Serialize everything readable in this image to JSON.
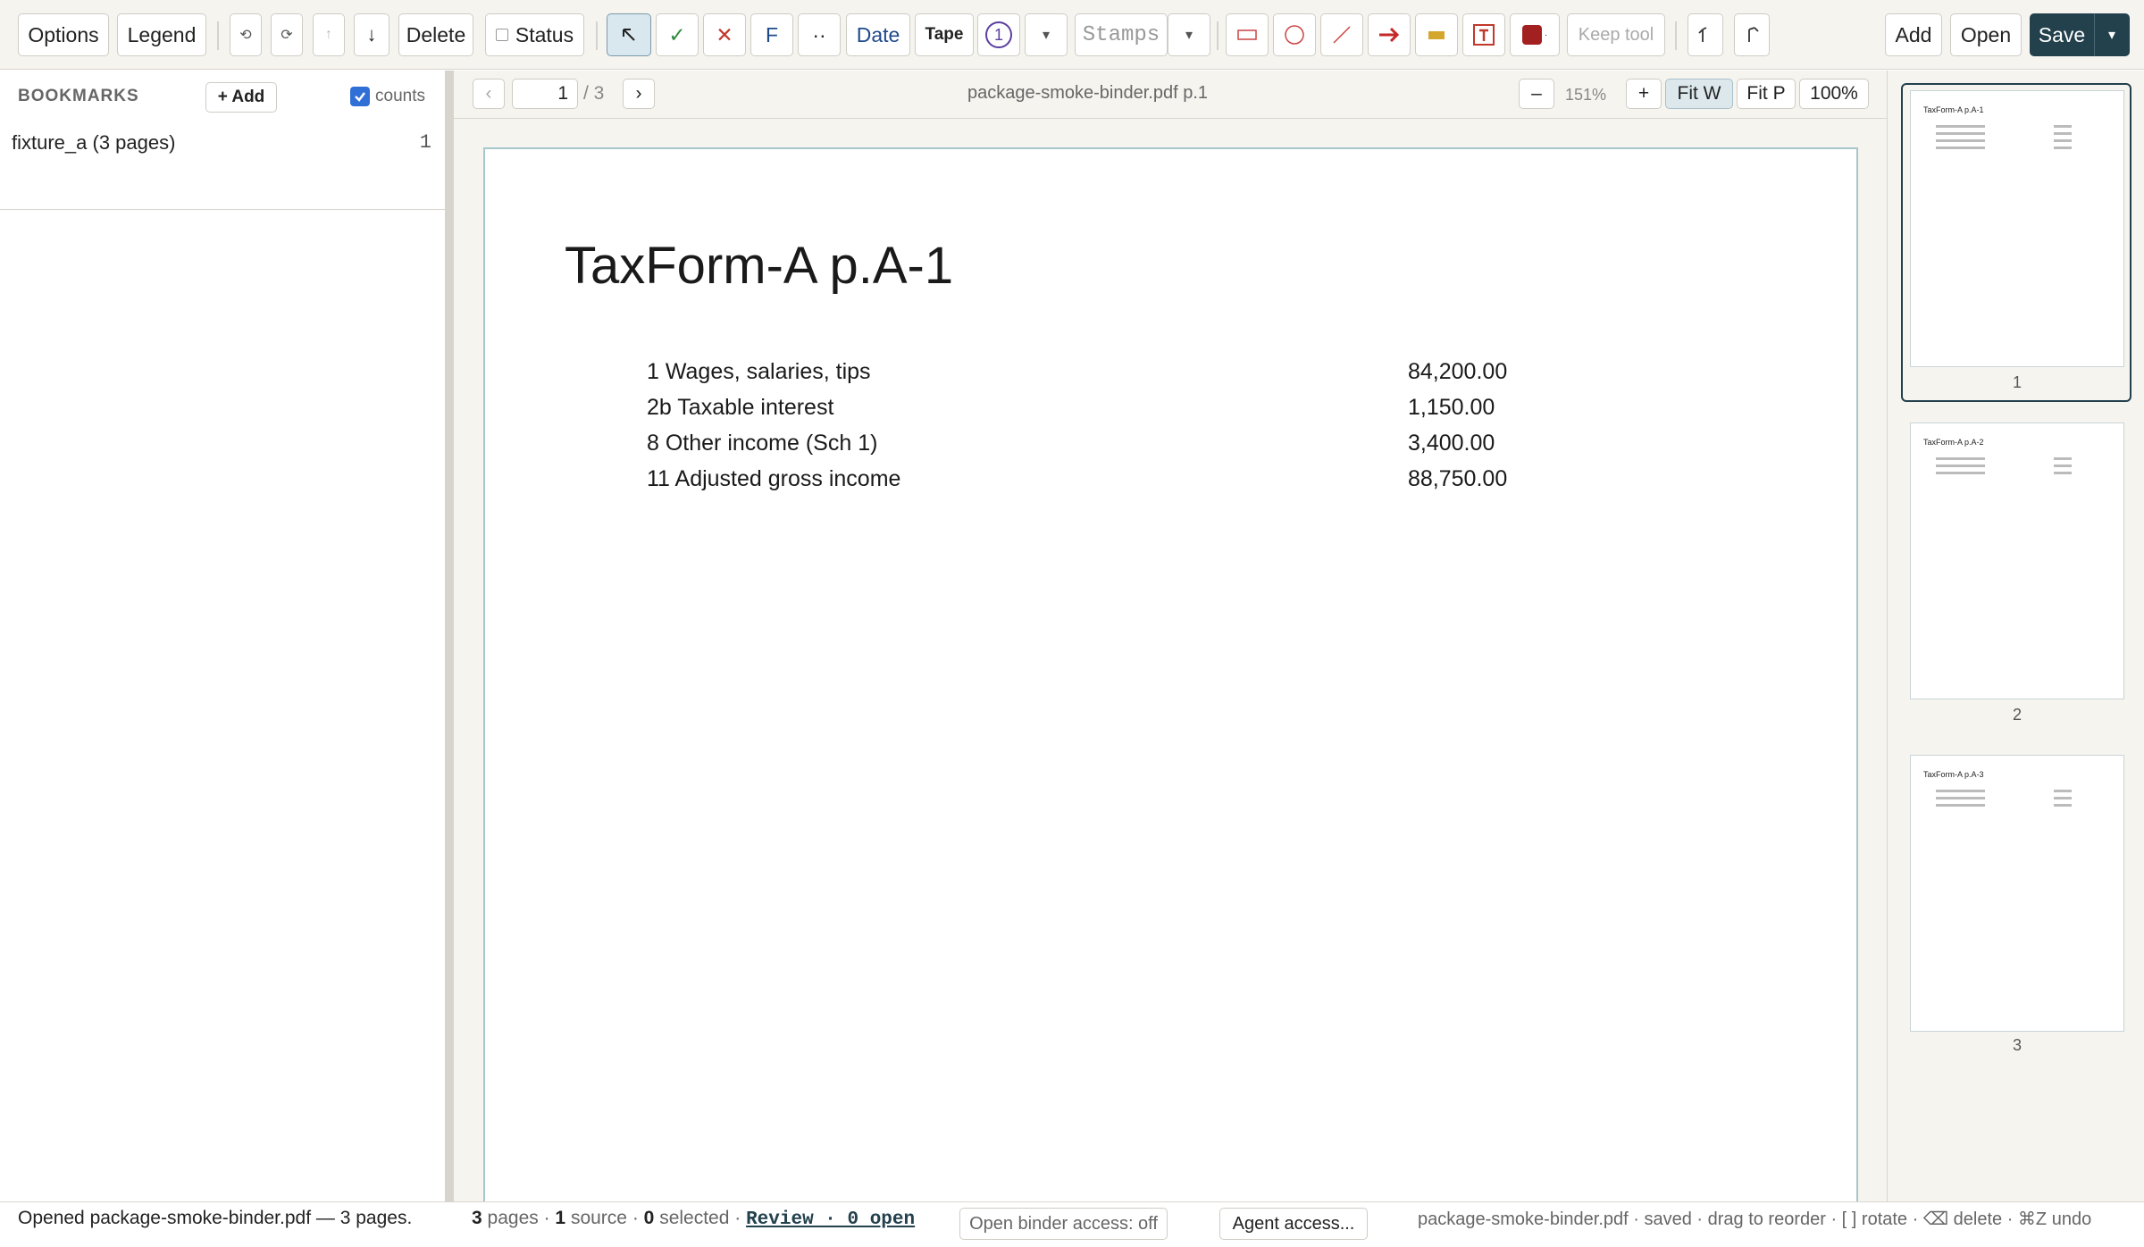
{
  "toolbar": {
    "options": "Options",
    "legend": "Legend",
    "rotate_left": "⟲",
    "rotate_right": "⟳",
    "move_up": "↑",
    "move_down": "↓",
    "delete": "Delete",
    "status": "Status",
    "check": "✓",
    "cross": "✕",
    "f_tool": "F",
    "dots": "··",
    "date": "Date",
    "tape": "Tape",
    "number": "1",
    "dropdown": "▾",
    "stamps": "Stamps",
    "keep_tool": "Keep tool",
    "add": "Add",
    "open": "Open",
    "save": "Save",
    "colors": {
      "accent": "#23404d",
      "check": "#2e8a3e",
      "cross": "#c0392b",
      "arrow": "#c62828",
      "highlight": "#d4a72c",
      "swatch": "#a32020",
      "number_ring": "#5b3fa0"
    }
  },
  "sidebar": {
    "header": "BOOKMARKS",
    "add_button": "+ Add",
    "counts_label": "counts",
    "counts_checked": true,
    "bookmarks": [
      {
        "title": "fixture_a (3 pages)",
        "page": "1"
      }
    ]
  },
  "viewer": {
    "prev": "‹",
    "next": "›",
    "current_page": "1",
    "page_total": "/ 3",
    "doc_title": "package-smoke-binder.pdf p.1",
    "zoom_out": "–",
    "zoom_level": "151%",
    "zoom_in": "+",
    "fit_width": "Fit W",
    "fit_page": "Fit P",
    "actual_size": "100%"
  },
  "page": {
    "title": "TaxForm-A  p.A-1",
    "lines": [
      {
        "label": "1  Wages, salaries, tips",
        "amount": "84,200.00"
      },
      {
        "label": "2b Taxable interest",
        "amount": "1,150.00"
      },
      {
        "label": "8  Other income (Sch 1)",
        "amount": "3,400.00"
      },
      {
        "label": "11 Adjusted gross income",
        "amount": "88,750.00"
      }
    ]
  },
  "thumbnails": [
    {
      "title": "TaxForm-A  p.A-1",
      "number": "1"
    },
    {
      "title": "TaxForm-A  p.A-2",
      "number": "2"
    },
    {
      "title": "TaxForm-A  p.A-3",
      "number": "3"
    }
  ],
  "status": {
    "message": "Opened package-smoke-binder.pdf — 3 pages.",
    "pages_count": "3",
    "pages_label": "pages ·",
    "source_count": "1",
    "source_label": "source ·",
    "selected_count": "0",
    "selected_label": "selected ·",
    "review": "Review · 0 open",
    "binder_access": "Open binder access: off",
    "agent_access": "Agent access...",
    "hint": "package-smoke-binder.pdf · saved · drag to reorder · [ ] rotate · ⌫ delete · ⌘Z undo"
  }
}
